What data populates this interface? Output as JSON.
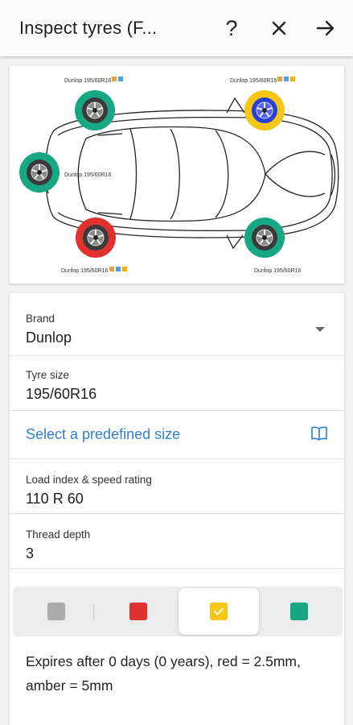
{
  "appbar": {
    "title": "Inspect tyres (F...",
    "help_icon": "help-icon",
    "close_icon": "close-icon",
    "next_icon": "arrow-right-icon"
  },
  "diagram": {
    "labels": {
      "rear_left": "Dunlop 195/60R16",
      "rear_right": "Dunlop 195/60R16",
      "spare": "Dunlop 195/60R16",
      "front_left": "Dunlop 195/60R16",
      "front_right": "Dunlop 195/60R16"
    },
    "wheel_status": {
      "rear_left": "green",
      "rear_right": "amber",
      "spare": "green",
      "front_left": "red",
      "front_right": "green"
    },
    "status_colors": {
      "green": "#17a782",
      "amber": "#f5c518",
      "red": "#e03131",
      "grey": "#aaaaaa"
    }
  },
  "form": {
    "brand": {
      "label": "Brand",
      "value": "Dunlop"
    },
    "tyre_size": {
      "label": "Tyre size",
      "value": "195/60R16"
    },
    "predefined": {
      "label": "Select a predefined size",
      "icon": "book-icon"
    },
    "load": {
      "label": "Load index & speed rating",
      "value": "110 R 60"
    },
    "depth": {
      "label": "Thread depth",
      "value": "3"
    }
  },
  "condition": {
    "options": [
      "grey",
      "red",
      "amber",
      "green"
    ],
    "selected": "amber"
  },
  "expires_text": "Expires after 0 days (0 years), red = 2.5mm, amber = 5mm"
}
